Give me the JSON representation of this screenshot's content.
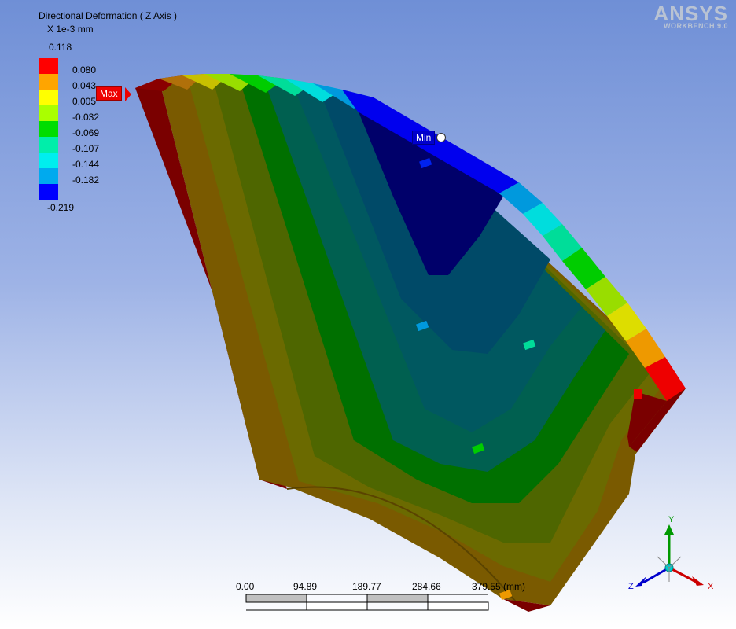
{
  "legend": {
    "title": "Directional Deformation ( Z Axis )",
    "unit": "X 1e-3 mm",
    "max": "0.118",
    "min": "-0.219",
    "ticks": [
      "0.080",
      "0.043",
      "0.005",
      "-0.032",
      "-0.069",
      "-0.107",
      "-0.144",
      "-0.182"
    ],
    "colors": [
      "#ff0000",
      "#ffa500",
      "#ffff00",
      "#aaff00",
      "#00dd00",
      "#00eeaa",
      "#00eeee",
      "#00aaee",
      "#0000ff"
    ]
  },
  "logo": {
    "brand": "ANSYS",
    "product": "WORKBENCH 9.0"
  },
  "probes": {
    "max_label": "Max",
    "min_label": "Min"
  },
  "scale_bar": {
    "labels": [
      "0.00",
      "94.89",
      "189.77",
      "284.66",
      "379.55 (mm)"
    ]
  },
  "triad": {
    "y": "Y",
    "x": "X",
    "z": "Z"
  },
  "colors": {
    "max_tag": "#ff0000",
    "min_tag": "#0000cc"
  }
}
